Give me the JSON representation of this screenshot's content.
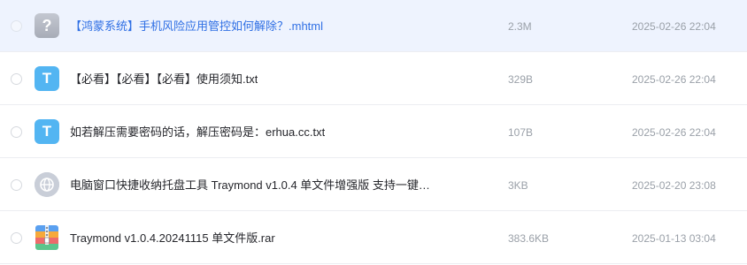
{
  "files": [
    {
      "name": "【鸿蒙系统】手机风险应用管控如何解除？.mhtml",
      "size": "2.3M",
      "date": "2025-02-26 22:04",
      "icon": "unknown-file-icon",
      "icon_glyph": "?",
      "selected": true
    },
    {
      "name": "【必看】【必看】【必看】使用须知.txt",
      "size": "329B",
      "date": "2025-02-26 22:04",
      "icon": "text-file-icon",
      "icon_glyph": "T",
      "selected": false
    },
    {
      "name": "如若解压需要密码的话，解压密码是：erhua.cc.txt",
      "size": "107B",
      "date": "2025-02-26 22:04",
      "icon": "text-file-icon",
      "icon_glyph": "T",
      "selected": false
    },
    {
      "name": "电脑窗口快捷收纳托盘工具 Traymond v1.0.4 单文件增强版 支持一键…",
      "size": "3KB",
      "date": "2025-02-20 23:08",
      "icon": "web-link-icon",
      "selected": false
    },
    {
      "name": "Traymond v1.0.4.20241115 单文件版.rar",
      "size": "383.6KB",
      "date": "2025-01-13 03:04",
      "icon": "archive-file-icon",
      "selected": false
    }
  ],
  "colors": {
    "selected_row_bg": "#eef3fe",
    "selected_text": "#2f6fe4",
    "txt_icon": "#53b5f2",
    "unknown_icon": "#b3b8c2"
  }
}
